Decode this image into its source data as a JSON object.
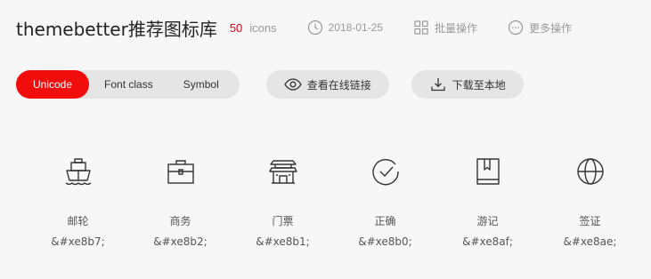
{
  "header": {
    "title": "themebetter推荐图标库",
    "icon_count": "50",
    "icon_count_unit": "icons",
    "date": "2018-01-25",
    "batch_action": "批量操作",
    "more_action": "更多操作"
  },
  "toolbar": {
    "tabs": [
      {
        "label": "Unicode",
        "active": true
      },
      {
        "label": "Font class",
        "active": false
      },
      {
        "label": "Symbol",
        "active": false
      }
    ],
    "view_online_label": "查看在线链接",
    "download_label": "下载至本地"
  },
  "icons": [
    {
      "name": "邮轮",
      "code": "&#xe8b7;",
      "icon": "ship-icon"
    },
    {
      "name": "商务",
      "code": "&#xe8b2;",
      "icon": "briefcase-icon"
    },
    {
      "name": "门票",
      "code": "&#xe8b1;",
      "icon": "gate-icon"
    },
    {
      "name": "正确",
      "code": "&#xe8b0;",
      "icon": "check-circle-icon"
    },
    {
      "name": "游记",
      "code": "&#xe8af;",
      "icon": "book-icon"
    },
    {
      "name": "签证",
      "code": "&#xe8ae;",
      "icon": "globe-icon"
    }
  ],
  "colors": {
    "accent": "#f20d0d",
    "count": "#e60012",
    "background": "#f7f7f7",
    "pill": "#e5e5e5"
  }
}
